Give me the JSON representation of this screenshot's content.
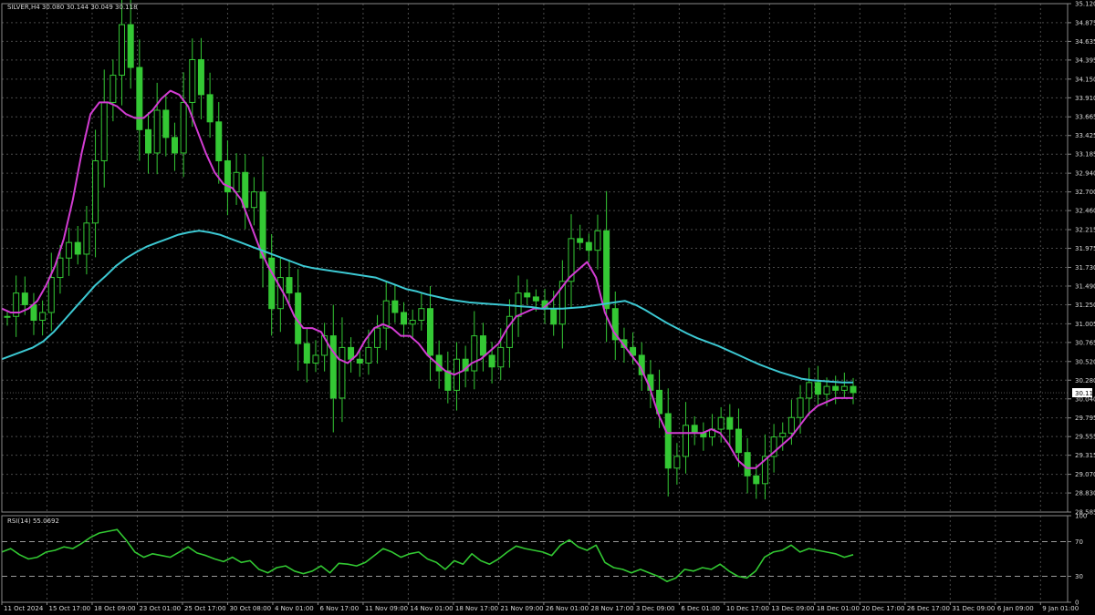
{
  "chart_header": {
    "text": "SILVER,H4  30.080 30.144 30.049 30.118"
  },
  "rsi_header": {
    "text": "RSI(14) 55.0692"
  },
  "current_price_tag": "30.118",
  "colors": {
    "background": "#000000",
    "grid": "#4a4a4a",
    "candle": "#34c834",
    "ma_fast": "#d23cd2",
    "ma_slow": "#3cc8d2",
    "rsi_line": "#32c832",
    "axis_text": "#d8d8d8"
  },
  "chart_data": [
    {
      "type": "candlestick",
      "title": "SILVER,H4",
      "x_ticks": [
        "11 Oct 2024",
        "15 Oct 17:00",
        "18 Oct 09:00",
        "23 Oct 01:00",
        "25 Oct 17:00",
        "30 Oct 08:00",
        "4 Nov 01:00",
        "6 Nov 17:00",
        "11 Nov 09:00",
        "14 Nov 01:00",
        "18 Nov 17:00",
        "21 Nov 09:00",
        "26 Nov 01:00",
        "28 Nov 17:00",
        "3 Dec 09:00",
        "6 Dec 01:00",
        "10 Dec 17:00",
        "13 Dec 09:00",
        "18 Dec 01:00",
        "20 Dec 17:00",
        "26 Dec 17:00",
        "31 Dec 09:00",
        "6 Jan 09:00",
        "9 Jan 01:00"
      ],
      "y_ticks": [
        "35.120",
        "34.875",
        "34.635",
        "34.395",
        "34.150",
        "33.910",
        "33.665",
        "33.425",
        "33.185",
        "32.940",
        "32.700",
        "32.460",
        "32.215",
        "31.975",
        "31.730",
        "31.490",
        "31.250",
        "31.005",
        "30.765",
        "30.520",
        "30.280",
        "30.040",
        "29.795",
        "29.555",
        "29.315",
        "29.070",
        "28.830",
        "28.585"
      ],
      "ylim": [
        28.585,
        35.12
      ],
      "series": [
        {
          "name": "Close",
          "values": [
            31.1,
            31.4,
            31.25,
            31.05,
            31.15,
            31.6,
            31.85,
            32.05,
            31.9,
            32.3,
            33.1,
            33.85,
            34.2,
            34.85,
            34.3,
            33.5,
            33.2,
            33.75,
            33.4,
            33.2,
            33.85,
            34.4,
            33.95,
            33.6,
            33.1,
            32.7,
            32.95,
            32.5,
            32.7,
            31.85,
            31.2,
            31.6,
            31.4,
            30.75,
            30.5,
            30.6,
            30.85,
            30.05,
            30.7,
            30.55,
            30.5,
            30.7,
            30.95,
            31.3,
            31.15,
            31.0,
            31.05,
            31.2,
            30.6,
            30.4,
            30.15,
            30.55,
            30.4,
            30.85,
            30.6,
            30.45,
            30.7,
            31.1,
            31.4,
            31.35,
            31.3,
            31.2,
            31.0,
            31.55,
            32.1,
            32.05,
            31.95,
            32.2,
            31.2,
            30.8,
            30.7,
            30.6,
            30.35,
            30.15,
            29.85,
            29.15,
            29.3,
            29.7,
            29.6,
            29.55,
            29.65,
            29.8,
            29.65,
            29.35,
            29.05,
            28.95,
            29.3,
            29.55,
            29.6,
            29.8,
            30.05,
            30.25,
            30.1,
            30.2,
            30.15,
            30.2,
            30.12
          ]
        },
        {
          "name": "MA fast",
          "values": [
            31.2,
            31.15,
            31.15,
            31.2,
            31.3,
            31.5,
            31.75,
            32.1,
            32.6,
            33.2,
            33.7,
            33.85,
            33.85,
            33.8,
            33.7,
            33.65,
            33.65,
            33.75,
            33.9,
            34.0,
            33.95,
            33.8,
            33.5,
            33.2,
            32.95,
            32.8,
            32.75,
            32.6,
            32.3,
            32.0,
            31.75,
            31.55,
            31.35,
            31.1,
            30.95,
            30.95,
            30.9,
            30.7,
            30.55,
            30.5,
            30.6,
            30.8,
            30.95,
            31.0,
            30.95,
            30.85,
            30.85,
            30.75,
            30.6,
            30.5,
            30.4,
            30.35,
            30.4,
            30.5,
            30.55,
            30.65,
            30.75,
            30.95,
            31.1,
            31.15,
            31.2,
            31.2,
            31.3,
            31.45,
            31.6,
            31.7,
            31.8,
            31.6,
            31.15,
            30.9,
            30.75,
            30.6,
            30.45,
            30.2,
            29.85,
            29.6,
            29.6,
            29.6,
            29.6,
            29.6,
            29.65,
            29.6,
            29.45,
            29.25,
            29.15,
            29.15,
            29.25,
            29.35,
            29.45,
            29.55,
            29.7,
            29.85,
            29.95,
            30.0,
            30.05,
            30.05,
            30.05
          ]
        },
        {
          "name": "MA slow",
          "values": [
            30.55,
            30.6,
            30.65,
            30.7,
            30.78,
            30.9,
            31.05,
            31.2,
            31.35,
            31.5,
            31.62,
            31.75,
            31.85,
            31.93,
            32.0,
            32.05,
            32.1,
            32.15,
            32.18,
            32.2,
            32.18,
            32.15,
            32.1,
            32.05,
            32.0,
            31.95,
            31.9,
            31.85,
            31.8,
            31.75,
            31.72,
            31.7,
            31.68,
            31.66,
            31.64,
            31.62,
            31.6,
            31.55,
            31.5,
            31.45,
            31.42,
            31.38,
            31.35,
            31.32,
            31.3,
            31.28,
            31.27,
            31.26,
            31.25,
            31.24,
            31.23,
            31.22,
            31.2,
            31.2,
            31.2,
            31.21,
            31.22,
            31.24,
            31.26,
            31.28,
            31.3,
            31.25,
            31.18,
            31.1,
            31.02,
            30.95,
            30.88,
            30.82,
            30.77,
            30.72,
            30.66,
            30.6,
            30.54,
            30.48,
            30.43,
            30.38,
            30.34,
            30.3,
            30.28,
            30.27,
            30.26,
            30.25,
            30.25
          ]
        }
      ]
    },
    {
      "type": "line",
      "title": "RSI(14) 55.0692",
      "ylim": [
        0,
        100
      ],
      "y_ticks": [
        "100",
        "70",
        "30",
        "0"
      ],
      "levels": [
        70,
        30
      ],
      "series": [
        {
          "name": "RSI(14)",
          "values": [
            58,
            62,
            55,
            50,
            52,
            58,
            60,
            64,
            62,
            68,
            75,
            80,
            82,
            84,
            72,
            58,
            52,
            56,
            54,
            52,
            58,
            64,
            57,
            54,
            50,
            47,
            52,
            46,
            48,
            38,
            34,
            40,
            42,
            36,
            33,
            36,
            42,
            34,
            45,
            44,
            42,
            46,
            54,
            62,
            58,
            52,
            56,
            58,
            50,
            46,
            38,
            48,
            44,
            56,
            48,
            44,
            50,
            58,
            65,
            62,
            60,
            58,
            54,
            66,
            72,
            64,
            60,
            66,
            46,
            40,
            38,
            34,
            38,
            34,
            30,
            24,
            28,
            38,
            36,
            40,
            38,
            44,
            36,
            30,
            28,
            36,
            52,
            58,
            60,
            66,
            58,
            62,
            60,
            58,
            56,
            52,
            55
          ]
        }
      ]
    }
  ]
}
